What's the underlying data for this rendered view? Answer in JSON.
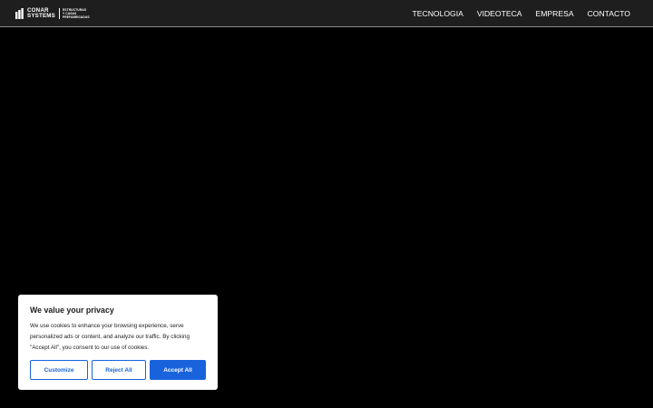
{
  "header": {
    "logo": {
      "name_line1": "CONAR",
      "name_line2": "SYSTEMS",
      "tagline_line1": "ESTRUCTURAS",
      "tagline_line2": "Y CASAS",
      "tagline_line3": "PREFABRICADAS",
      "icon": "building-icon"
    },
    "nav": [
      {
        "label": "TECNOLOGIA"
      },
      {
        "label": "VIDEOTECA"
      },
      {
        "label": "EMPRESA"
      },
      {
        "label": "CONTACTO"
      }
    ]
  },
  "cookie_banner": {
    "title": "We value your privacy",
    "message": "We use cookies to enhance your browsing experience, serve personalized ads or content, and analyze our traffic. By clicking \"Accept All\", you consent to our use of cookies.",
    "buttons": {
      "customize": "Customize",
      "reject": "Reject All",
      "accept": "Accept All"
    },
    "accent_color": "#1863dc"
  },
  "colors": {
    "background": "#000000",
    "header_background": "#1e1e1e",
    "text_light": "#ffffff"
  }
}
